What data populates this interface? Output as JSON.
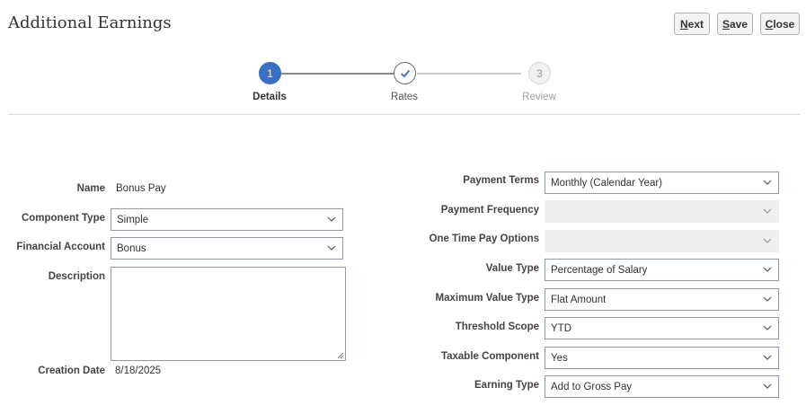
{
  "page": {
    "title": "Additional Earnings"
  },
  "toolbar": {
    "next_first": "N",
    "next_rest": "ext",
    "save_first": "S",
    "save_rest": "ave",
    "close_first": "C",
    "close_rest": "lose"
  },
  "train": {
    "steps": [
      {
        "number": "1",
        "label": "Details",
        "state": "current"
      },
      {
        "number": "",
        "label": "Rates",
        "state": "visited"
      },
      {
        "number": "3",
        "label": "Review",
        "state": "future"
      }
    ]
  },
  "left": {
    "name_label": "Name",
    "name_value": "Bonus Pay",
    "component_type_label": "Component Type",
    "component_type_value": "Simple",
    "financial_account_label": "Financial Account",
    "financial_account_value": "Bonus",
    "description_label": "Description",
    "description_value": "",
    "creation_date_label": "Creation Date",
    "creation_date_value": "8/18/2025"
  },
  "right": {
    "payment_terms_label": "Payment Terms",
    "payment_terms_value": "Monthly (Calendar Year)",
    "payment_frequency_label": "Payment Frequency",
    "payment_frequency_value": "",
    "one_time_pay_label": "One Time Pay Options",
    "one_time_pay_value": "",
    "value_type_label": "Value Type",
    "value_type_value": "Percentage of Salary",
    "max_value_type_label": "Maximum Value Type",
    "max_value_type_value": "Flat Amount",
    "threshold_scope_label": "Threshold Scope",
    "threshold_scope_value": "YTD",
    "taxable_component_label": "Taxable Component",
    "taxable_component_value": "Yes",
    "earning_type_label": "Earning Type",
    "earning_type_value": "Add to Gross Pay"
  },
  "colors": {
    "accent": "#3a6fc4",
    "field_border": "#8d9aa6",
    "disabled_field": "#efefef"
  },
  "icons": {
    "dropdown": "chevron-down-icon",
    "visited_step": "checkmark-icon",
    "resize": "resize-handle-icon"
  }
}
